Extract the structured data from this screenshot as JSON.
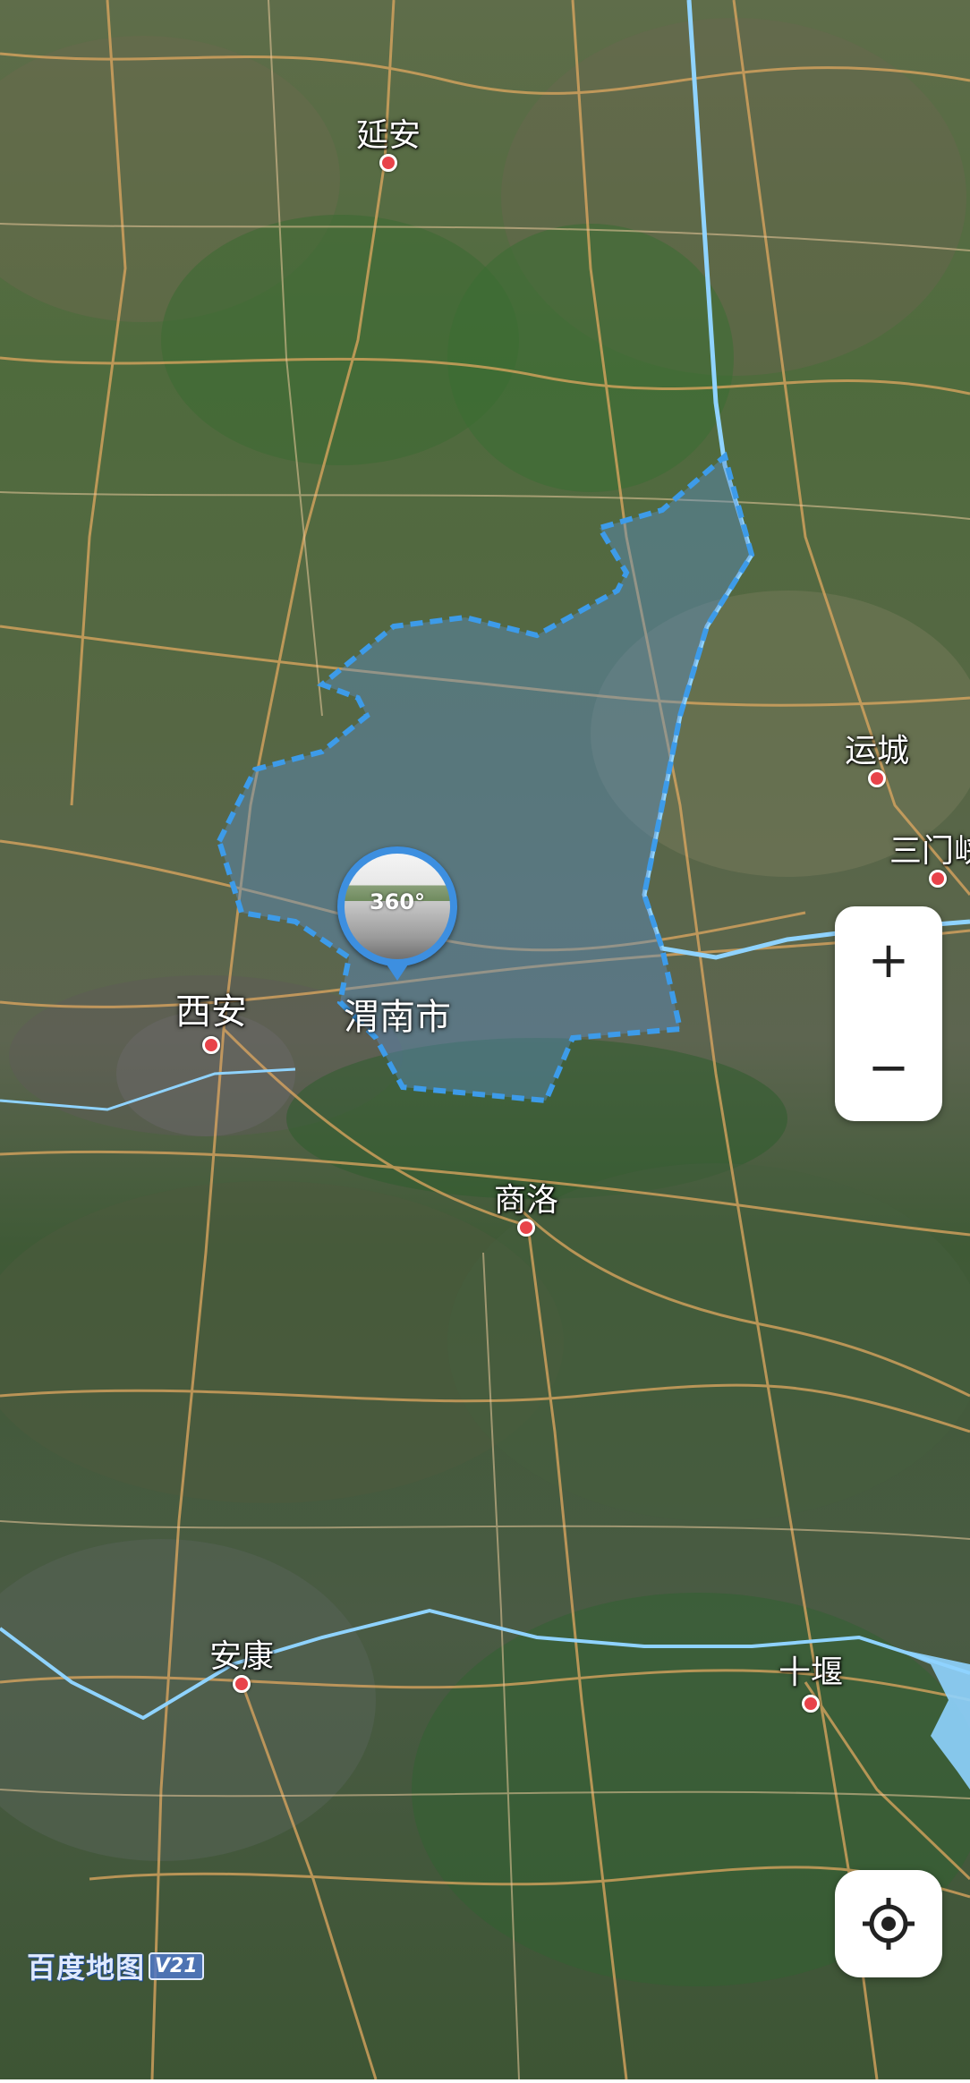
{
  "map": {
    "type": "satellite",
    "highlighted_region": "渭南市",
    "cities": [
      {
        "id": "yanan",
        "name": "延安"
      },
      {
        "id": "yuncheng",
        "name": "运城"
      },
      {
        "id": "sanmenxia",
        "name": "三门峡"
      },
      {
        "id": "xian",
        "name": "西安"
      },
      {
        "id": "shangluo",
        "name": "商洛"
      },
      {
        "id": "ankang",
        "name": "安康"
      },
      {
        "id": "shiyan",
        "name": "十堰"
      }
    ],
    "pin": {
      "label": "渭南市",
      "photo_text": "360°",
      "icon": "panorama-photo-icon"
    }
  },
  "controls": {
    "zoom_in": "+",
    "zoom_out": "−",
    "locate_icon": "crosshair-locate-icon"
  },
  "logo": {
    "text": "百度地图",
    "version": "V21"
  },
  "colors": {
    "region_border": "#3d9be9",
    "region_fill": "#5a8fc8",
    "river": "#8fd3ff",
    "road": "#e0a860",
    "city_dot": "#e8434a"
  }
}
